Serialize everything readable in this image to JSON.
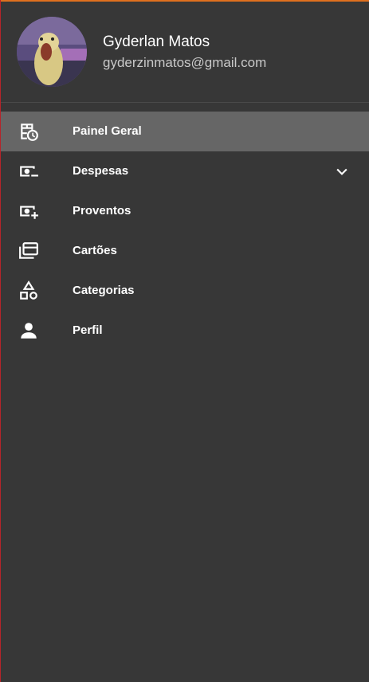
{
  "colors": {
    "background": "#373737",
    "active_item": "#666666",
    "divider": "#4a4a4a",
    "text_primary": "#ffffff",
    "text_secondary": "#c9c9c9",
    "top_accent": "#e0701e",
    "left_accent": "#b5242a"
  },
  "user": {
    "name": "Gyderlan Matos",
    "email": "gyderzinmatos@gmail.com",
    "avatar": "avatar-photo"
  },
  "menu": {
    "items": [
      {
        "label": "Painel Geral",
        "icon": "dashboard-icon",
        "active": true
      },
      {
        "label": "Despesas",
        "icon": "cash-minus-icon",
        "expandable": true,
        "expand_icon": "chevron-down-icon"
      },
      {
        "label": "Proventos",
        "icon": "cash-plus-icon"
      },
      {
        "label": "Cartões",
        "icon": "cards-icon"
      },
      {
        "label": "Categorias",
        "icon": "shapes-icon"
      },
      {
        "label": "Perfil",
        "icon": "person-icon"
      }
    ]
  }
}
